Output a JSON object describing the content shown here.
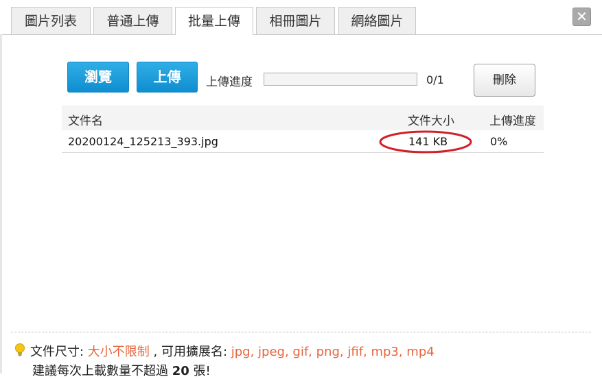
{
  "tabs": [
    {
      "label": "圖片列表"
    },
    {
      "label": "普通上傳"
    },
    {
      "label": "批量上傳",
      "active": true
    },
    {
      "label": "相冊圖片"
    },
    {
      "label": "網絡圖片"
    }
  ],
  "close_glyph": "✕",
  "toolbar": {
    "browse_label": "瀏覽",
    "upload_label": "上傳",
    "progress_label": "上傳進度",
    "progress_count": "0/1",
    "progress_fraction": 0,
    "delete_label": "刪除"
  },
  "table": {
    "headers": {
      "name": "文件名",
      "size": "文件大小",
      "progress": "上傳進度"
    },
    "rows": [
      {
        "name": "20200124_125213_393.jpg",
        "size": "141 KB",
        "progress": "0%"
      }
    ]
  },
  "footer": {
    "size_label": "文件尺寸: ",
    "size_value": "大小不限制",
    "ext_label": " , 可用擴展名: ",
    "ext_value": "jpg, jpeg, gif, png, jfif, mp3, mp4",
    "tip_prefix": "建議每次上載數量不超過 ",
    "tip_count": "20",
    "tip_suffix": " 張!"
  },
  "colors": {
    "accent": "#1a9ad8",
    "highlight": "#d0202a",
    "orange": "#e8643a"
  },
  "icons": {
    "bulb": "lightbulb-icon",
    "close": "close-icon"
  }
}
